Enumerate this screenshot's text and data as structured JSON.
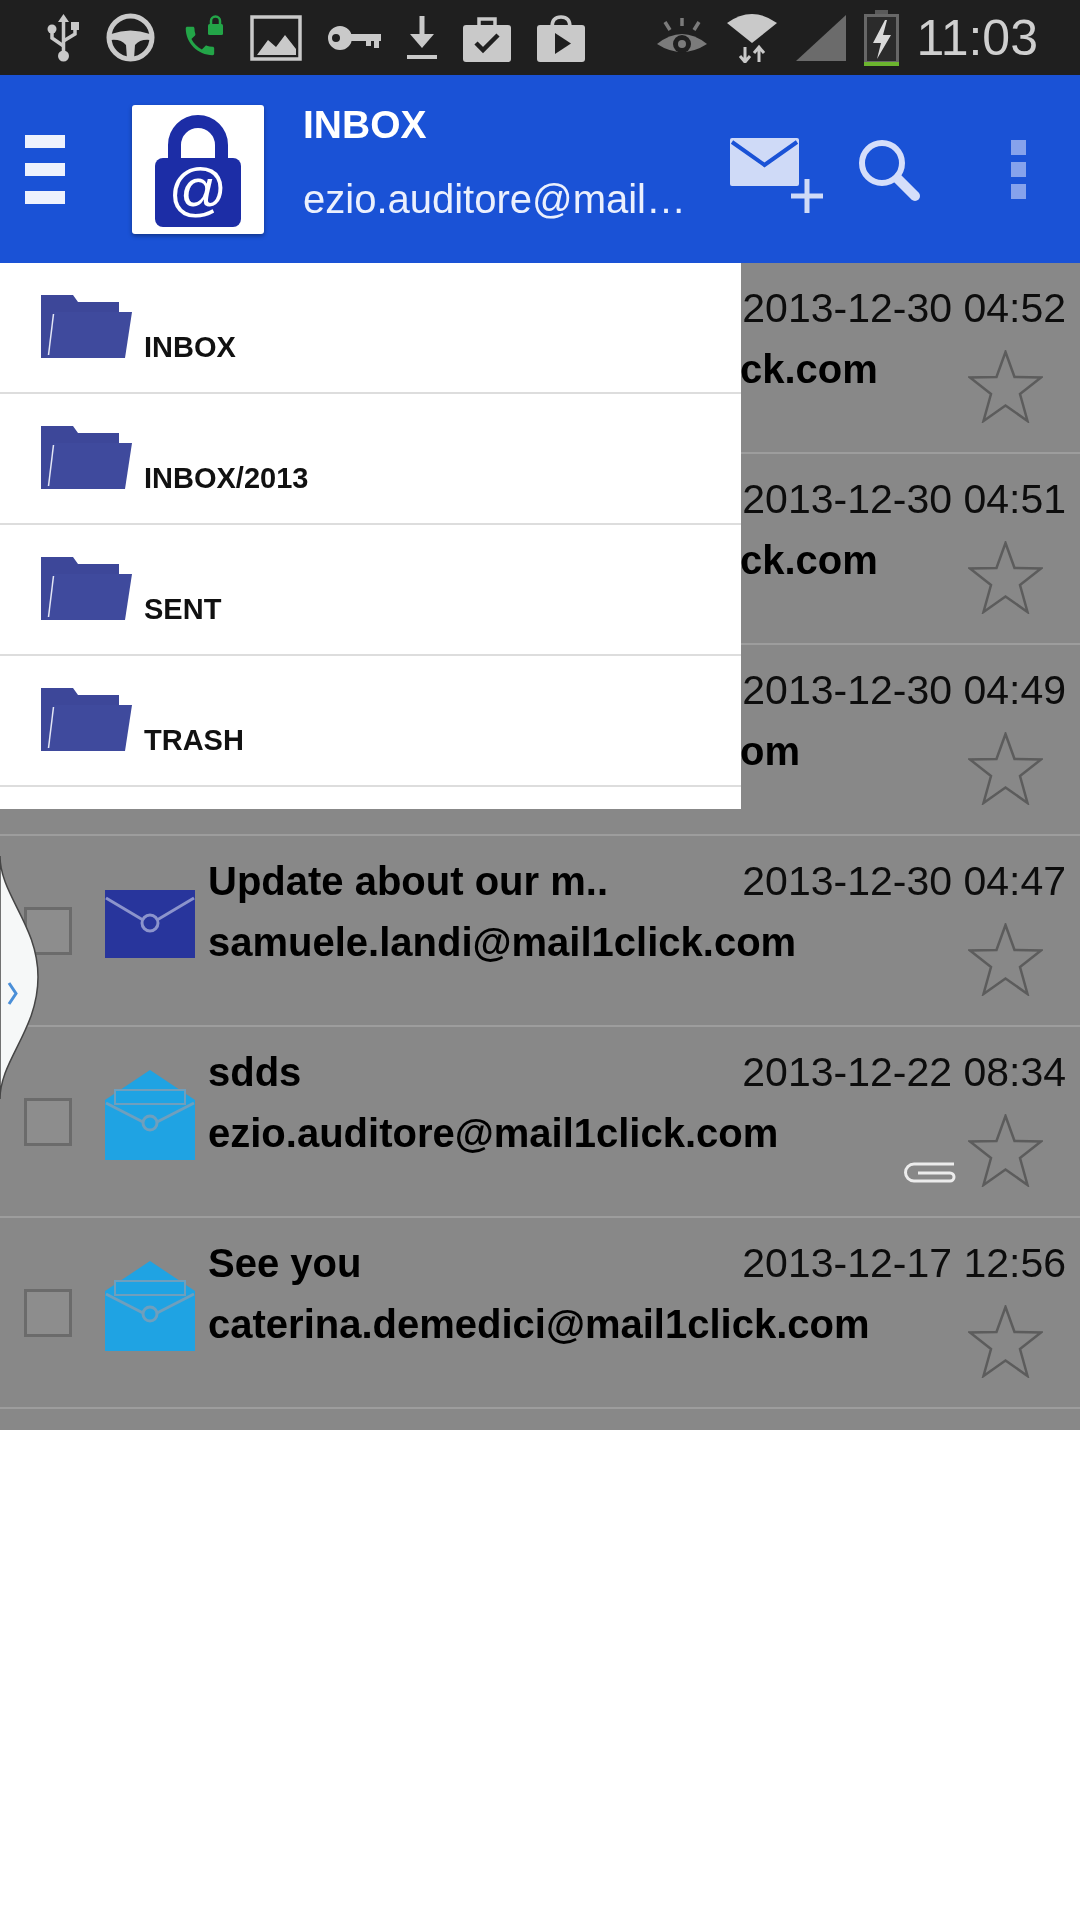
{
  "status_bar": {
    "time": "11:03"
  },
  "app_bar": {
    "logo_mark": "@",
    "title": "INBOX",
    "subtitle": "ezio.auditore@mail…"
  },
  "folder_menu": [
    {
      "label": "INBOX"
    },
    {
      "label": "INBOX/2013"
    },
    {
      "label": "SENT"
    },
    {
      "label": "TRASH"
    }
  ],
  "messages": [
    {
      "kind": "covered",
      "date": "2013-12-30 04:52",
      "sender": "ck.com",
      "starred": false,
      "attachment": false
    },
    {
      "kind": "covered",
      "date": "2013-12-30 04:51",
      "sender": "ck.com",
      "starred": false,
      "attachment": false
    },
    {
      "kind": "covered",
      "date": "2013-12-30 04:49",
      "sender": "om",
      "starred": false,
      "attachment": false
    },
    {
      "kind": "full",
      "subject": "Update about our m..",
      "date": "2013-12-30 04:47",
      "sender": "samuele.landi@mail1click.com",
      "checked": false,
      "read": false,
      "starred": false,
      "attachment": false
    },
    {
      "kind": "full",
      "subject": "sdds",
      "date": "2013-12-22 08:34",
      "sender": "ezio.auditore@mail1click.com",
      "checked": false,
      "read": true,
      "starred": false,
      "attachment": true
    },
    {
      "kind": "full",
      "subject": "See you",
      "date": "2013-12-17 12:56",
      "sender": "caterina.demedici@mail1click.com",
      "checked": false,
      "read": true,
      "starred": false,
      "attachment": false
    }
  ]
}
